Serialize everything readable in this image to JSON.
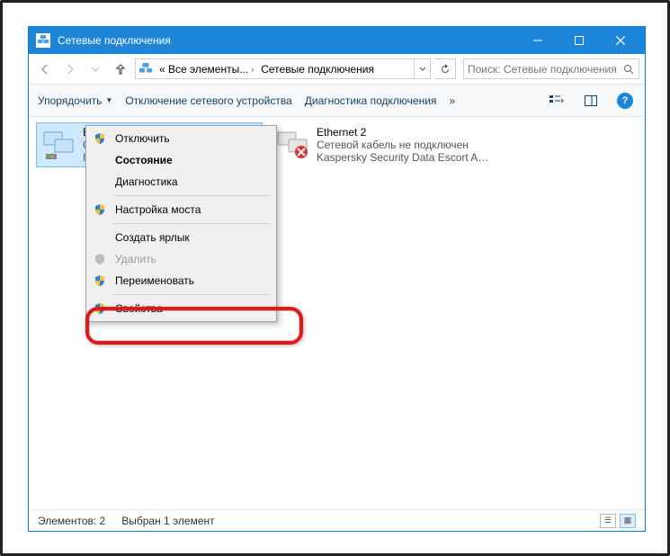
{
  "window": {
    "title": "Сетевые подключения"
  },
  "address": {
    "seg1": "« Все элементы...",
    "seg2": "Сетевые подключения"
  },
  "search": {
    "placeholder": "Поиск: Сетевые подключения"
  },
  "cmdbar": {
    "organize": "Упорядочить",
    "disable": "Отключение сетевого устройства",
    "diagnose": "Диагностика подключения",
    "more": "»"
  },
  "items": [
    {
      "name": "Ethernet",
      "line2": "Сеть",
      "line3": "Inte"
    },
    {
      "name": "Ethernet 2",
      "line2": "Сетевой кабель не подключен",
      "line3": "Kaspersky Security Data Escort Ad..."
    }
  ],
  "context_menu": [
    {
      "label": "Отключить",
      "shield": true,
      "enabled": true,
      "bold": false,
      "sep_after": false
    },
    {
      "label": "Состояние",
      "shield": false,
      "enabled": true,
      "bold": true,
      "sep_after": false
    },
    {
      "label": "Диагностика",
      "shield": false,
      "enabled": true,
      "bold": false,
      "sep_after": true
    },
    {
      "label": "Настройка моста",
      "shield": true,
      "enabled": true,
      "bold": false,
      "sep_after": true
    },
    {
      "label": "Создать ярлык",
      "shield": false,
      "enabled": true,
      "bold": false,
      "sep_after": false
    },
    {
      "label": "Удалить",
      "shield": true,
      "enabled": false,
      "bold": false,
      "sep_after": false
    },
    {
      "label": "Переименовать",
      "shield": true,
      "enabled": true,
      "bold": false,
      "sep_after": true
    },
    {
      "label": "Свойства",
      "shield": true,
      "enabled": true,
      "bold": false,
      "sep_after": false
    }
  ],
  "statusbar": {
    "count": "Элементов: 2",
    "selected": "Выбран 1 элемент"
  }
}
